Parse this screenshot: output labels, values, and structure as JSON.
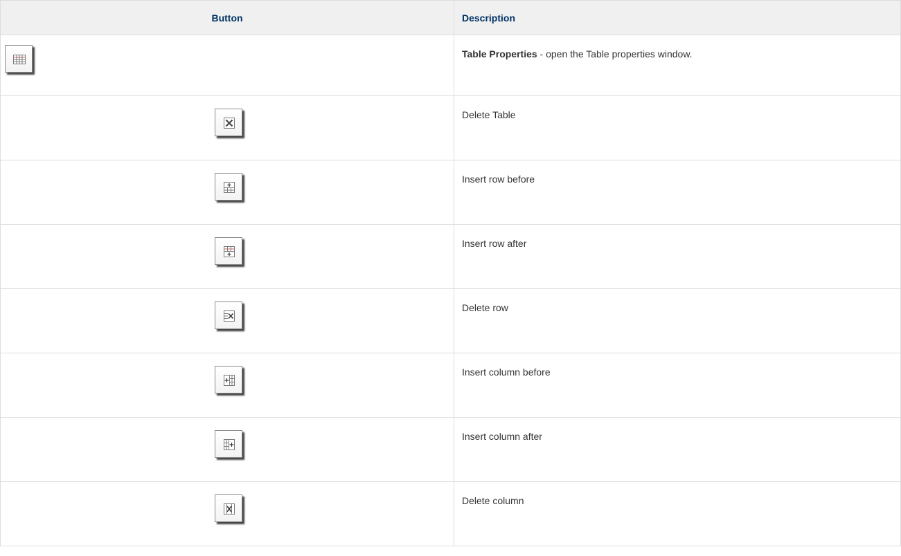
{
  "table": {
    "headers": {
      "button": "Button",
      "description": "Description"
    },
    "rows": [
      {
        "icon": "table-properties-icon",
        "title": "Table Properties",
        "text": " - open the Table properties window."
      },
      {
        "icon": "delete-table-icon",
        "text": "Delete Table"
      },
      {
        "icon": "insert-row-before-icon",
        "text": "Insert row before"
      },
      {
        "icon": "insert-row-after-icon",
        "text": "Insert row after"
      },
      {
        "icon": "delete-row-icon",
        "text": "Delete row"
      },
      {
        "icon": "insert-column-before-icon",
        "text": "Insert column before"
      },
      {
        "icon": "insert-column-after-icon",
        "text": "Insert column after"
      },
      {
        "icon": "delete-column-icon",
        "text": "Delete column"
      }
    ]
  },
  "colors": {
    "header_text": "#003366",
    "header_bg": "#f0f0f0",
    "border": "#dddddd",
    "body_text": "#333333"
  }
}
